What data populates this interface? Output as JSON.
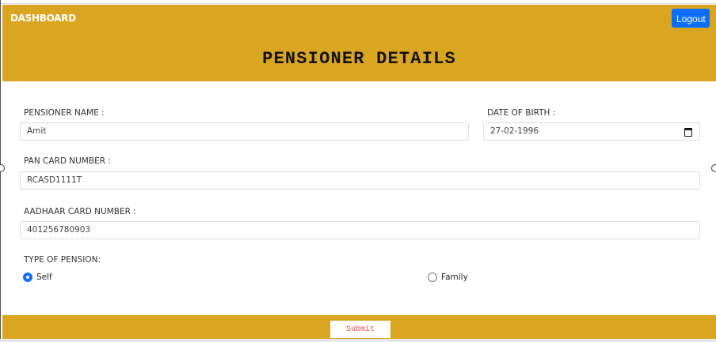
{
  "header": {
    "brand": "DASHBOARD",
    "logout_label": "Logout",
    "title": "PENSIONER DETAILS"
  },
  "form": {
    "pensioner_name": {
      "label": "PENSIONER NAME :",
      "value": "Amit"
    },
    "date_of_birth": {
      "label": "DATE OF BIRTH :",
      "value": "27-02-1996",
      "icon": "calendar-icon"
    },
    "pan_card": {
      "label": "PAN CARD NUMBER :",
      "value": "RCASD1111T"
    },
    "aadhaar_card": {
      "label": "AADHAAR CARD NUMBER :",
      "value": "401256780903"
    },
    "pension_type": {
      "label": "TYPE OF PENSION:",
      "options": [
        {
          "label": "Self",
          "checked": true
        },
        {
          "label": "Family",
          "checked": false
        }
      ]
    }
  },
  "footer": {
    "submit_label": "Submit"
  },
  "colors": {
    "header_bg": "#daa520",
    "logout_bg": "#0d6efd",
    "radio_accent": "#0d6efd",
    "submit_text": "#e05050"
  }
}
